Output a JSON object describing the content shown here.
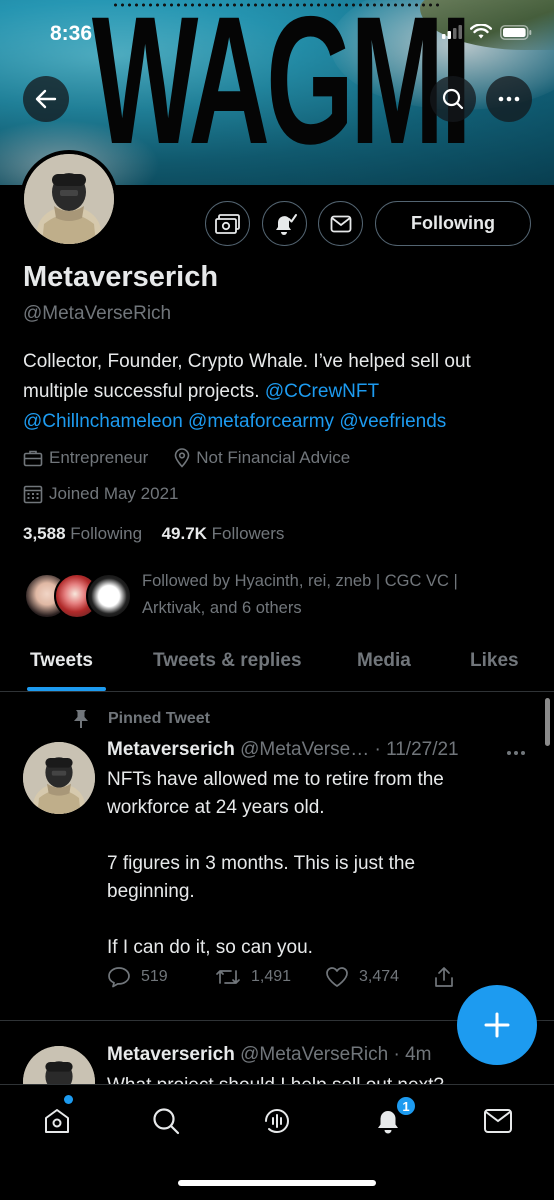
{
  "status_bar": {
    "time": "8:36"
  },
  "banner": {
    "text": "WAGMI"
  },
  "profile": {
    "name": "Metaverserich",
    "handle": "@MetaVerseRich",
    "following_button": "Following",
    "bio": {
      "text_line1": "Collector, Founder, Crypto Whale. I’ve helped sell out",
      "text_line2": "multiple successful projects. ",
      "mention1": "@CCrewNFT",
      "mention2": "@Chillnchameleon",
      "mention3": "@metaforcearmy",
      "mention4": "@veefriends"
    },
    "profession": "Entrepreneur",
    "location": "Not Financial Advice",
    "joined": "Joined May 2021",
    "following_count": "3,588",
    "following_label": "Following",
    "followers_count": "49.7K",
    "followers_label": "Followers",
    "followed_by_line1": "Followed by Hyacinth, rei, zneb | CGC VC |",
    "followed_by_line2": "Arktivak, and 6 others"
  },
  "tabs": [
    "Tweets",
    "Tweets & replies",
    "Media",
    "Likes"
  ],
  "pinned_label": "Pinned Tweet",
  "tweets": [
    {
      "name": "Metaverserich",
      "meta": "@MetaVerse… · 11/27/21",
      "line1": "NFTs have allowed me to retire from the",
      "line2": "workforce at 24 years old.",
      "line3": "7 figures in 3 months. This is just the",
      "line4": "beginning.",
      "line5": "If I can do it, so can you.",
      "replies": "519",
      "retweets": "1,491",
      "likes": "3,474"
    },
    {
      "name": "Metaverserich",
      "meta": "@MetaVerseRich · 4m",
      "line1": "What project should I help sell out next?"
    }
  ],
  "bottom_nav": {
    "notifications_badge": "1"
  },
  "colors": {
    "accent": "#1d9bf0",
    "background": "#000000",
    "muted": "#71767b",
    "text": "#e7e9ea"
  }
}
